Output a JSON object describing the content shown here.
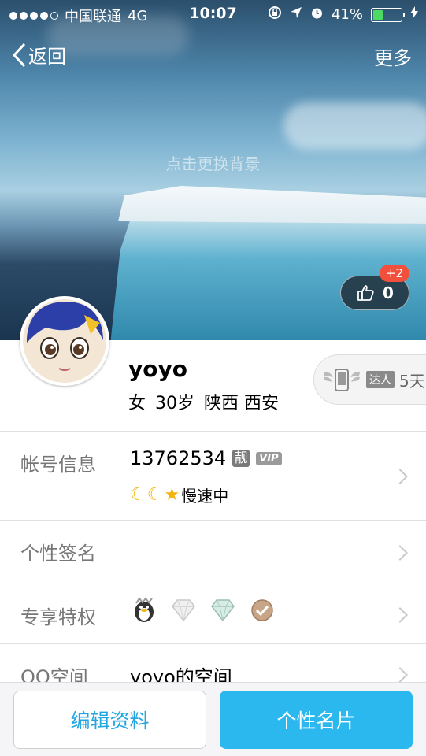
{
  "status_bar": {
    "carrier": "中国联通",
    "network": "4G",
    "time": "10:07",
    "battery": "41%",
    "battery_level": 0.41
  },
  "nav": {
    "back_label": "返回",
    "more_label": "更多"
  },
  "header": {
    "background_hint": "点击更换背景",
    "like_count": "0",
    "like_badge": "+2"
  },
  "profile": {
    "name": "yoyo",
    "gender": "女",
    "age": "30岁",
    "province": "陕西",
    "city": "西安",
    "daren_label": "达人",
    "daren_days": "5天"
  },
  "rows": {
    "account": {
      "label": "帐号信息",
      "number": "13762534",
      "liang_badge": "靓",
      "vip_badge": "VIP",
      "speed_text": "慢速中"
    },
    "signature": {
      "label": "个性签名"
    },
    "privileges": {
      "label": "专享特权"
    },
    "qzone": {
      "label": "QQ空间",
      "value": "yoyo的空间"
    }
  },
  "bottom": {
    "edit_label": "编辑资料",
    "card_label": "个性名片"
  },
  "colors": {
    "accent_blue": "#2ab8ef",
    "badge_red": "#f2503c",
    "battery_green": "#4cd964"
  }
}
